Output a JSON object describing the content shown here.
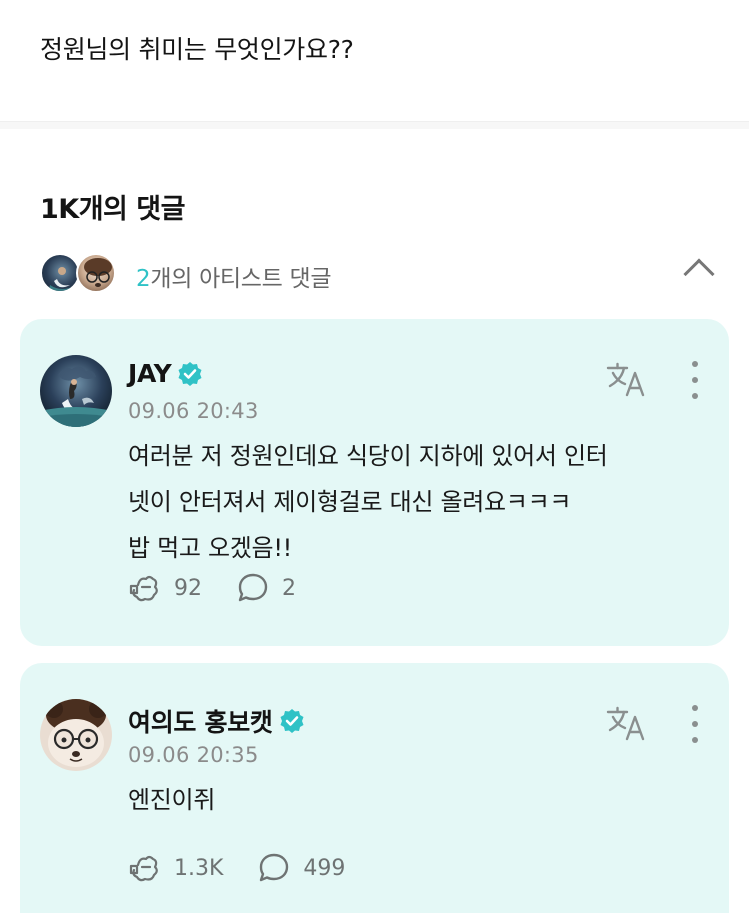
{
  "post": {
    "question": "정원님의 취미는 무엇인가요??"
  },
  "comments_section": {
    "count_title": "1K개의 댓글",
    "artist_comments": {
      "count": "2",
      "label": "개의 아티스트 댓글"
    }
  },
  "comments": [
    {
      "author": "JAY",
      "verified": true,
      "time": "09.06 20:43",
      "text": "여러분 저 정원인데요 식당이 지하에 있어서 인터\n넷이 안터져서 제이형걸로 대신 올려요ㅋㅋㅋ\n밥 먹고 오겠음!!",
      "likes": "92",
      "replies": "2"
    },
    {
      "author": "여의도 홍보캣",
      "verified": true,
      "time": "09.06 20:35",
      "text": "엔진이쥐",
      "likes": "1.3K",
      "replies": "499"
    }
  ],
  "colors": {
    "card_bg": "#e4f8f6",
    "accent": "#2fc2c6",
    "verified_badge": "#2fc2c6"
  }
}
